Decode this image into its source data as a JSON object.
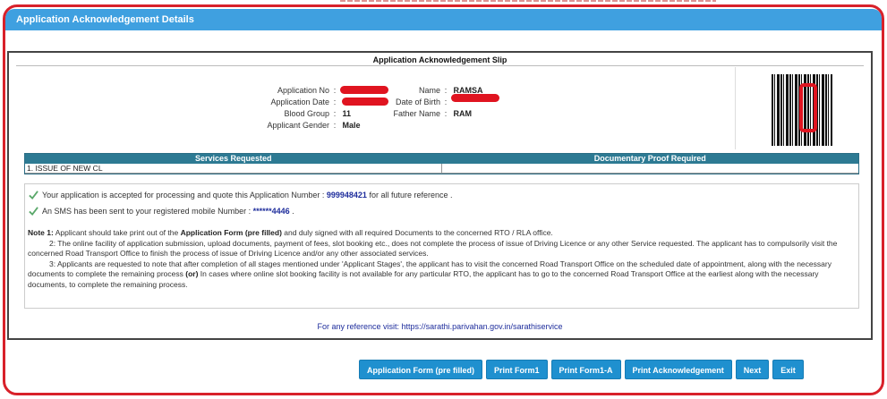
{
  "panel": {
    "title": "Application Acknowledgement Details"
  },
  "slip": {
    "title": "Application Acknowledgement Slip",
    "fields": {
      "application_no_label": "Application No",
      "application_date_label": "Application Date",
      "blood_group_label": "Blood Group",
      "blood_group_value": "11",
      "applicant_gender_label": "Applicant Gender",
      "applicant_gender_value": "Male",
      "name_label": "Name",
      "name_value": "RAMSA",
      "dob_label": "Date of Birth",
      "father_name_label": "Father Name",
      "father_name_value": "RAM"
    },
    "services": {
      "headers": [
        "Services Requested",
        "Documentary Proof Required"
      ],
      "rows": [
        [
          "1. ISSUE OF NEW CL",
          ""
        ]
      ]
    },
    "messages": {
      "accepted_prefix": "Your application is accepted for processing and quote this Application Number : ",
      "application_number": "999948421",
      "accepted_suffix": " for all future reference .",
      "sms_prefix": "An SMS has been sent to your registered mobile Number : ",
      "mobile_masked": "******4446",
      "sms_suffix": " ."
    },
    "notes": {
      "note1_label": "Note 1:",
      "note1_a": " Applicant should take print out of the ",
      "note1_bold": "Application Form (pre filled)",
      "note1_b": " and duly signed with all required Documents to the concerned RTO / RLA office.",
      "note2": "2:  The online facility of application submission, upload documents, payment of fees, slot booking etc., does not complete the process of issue of Driving Licence or any other Service requested. The applicant has to compulsorily visit the concerned Road Transport Office to finish the process of issue of Driving Licence and/or any other associated services.",
      "note3_a": "3:  Applicants are requested to note that after completion of all stages mentioned under 'Applicant Stages', the applicant has to visit the concerned Road Transport Office on the scheduled date of appointment, along with the necessary documents to complete the remaining process ",
      "note3_bold": "(or)",
      "note3_b": " In cases where online slot booking facility is not available for any particular RTO, the applicant has to go to the concerned Road Transport Office at the earliest along with the necessary documents, to complete the remaining process."
    },
    "reference": "For any reference visit: https://sarathi.parivahan.gov.in/sarathiservice"
  },
  "buttons": {
    "application_form": "Application Form (pre filled)",
    "print_form1": "Print Form1",
    "print_form1a": "Print Form1-A",
    "print_ack": "Print Acknowledgement",
    "next": "Next",
    "exit": "Exit"
  },
  "colors": {
    "header_blue": "#3fa0e0",
    "table_header": "#2d7a93",
    "button_blue": "#1f90cf",
    "annotation_red": "#d8212a",
    "link_blue": "#1e2d9c"
  }
}
